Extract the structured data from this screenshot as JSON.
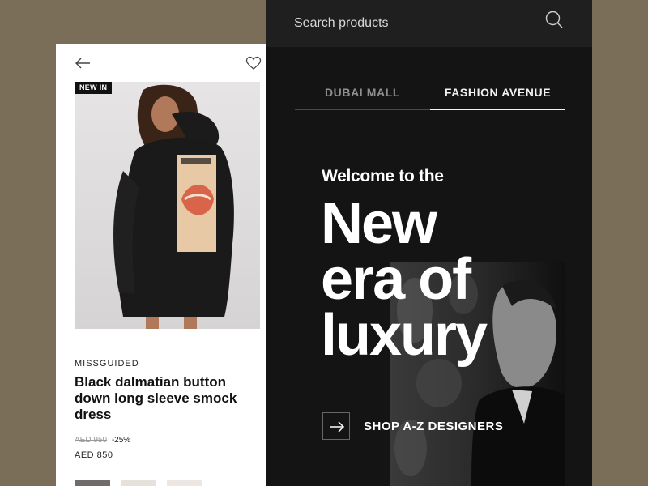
{
  "product": {
    "badge": "NEW IN",
    "brand": "MISSGUIDED",
    "title": "Black dalmatian button down long sleeve smock dress",
    "old_price": "AED 950",
    "discount": "-25%",
    "price": "AED 850",
    "back_icon": "arrow-left-icon",
    "wishlist_icon": "heart-outline-icon"
  },
  "search": {
    "placeholder": "Search products",
    "icon": "search-icon"
  },
  "tabs": [
    {
      "label": "DUBAI MALL",
      "active": false
    },
    {
      "label": "FASHION AVENUE",
      "active": true
    }
  ],
  "hero": {
    "welcome": "Welcome to the",
    "headline_lines": [
      "New",
      "era of",
      "luxury"
    ],
    "cta_label": "SHOP A-Z DESIGNERS",
    "cta_icon": "arrow-right-icon"
  },
  "colors": {
    "background": "#7a6e58",
    "panel_dark": "#141414",
    "search_bar": "#1f1f1f",
    "active_tab": "#f2f2f2",
    "inactive_tab": "#8f8f8f"
  }
}
